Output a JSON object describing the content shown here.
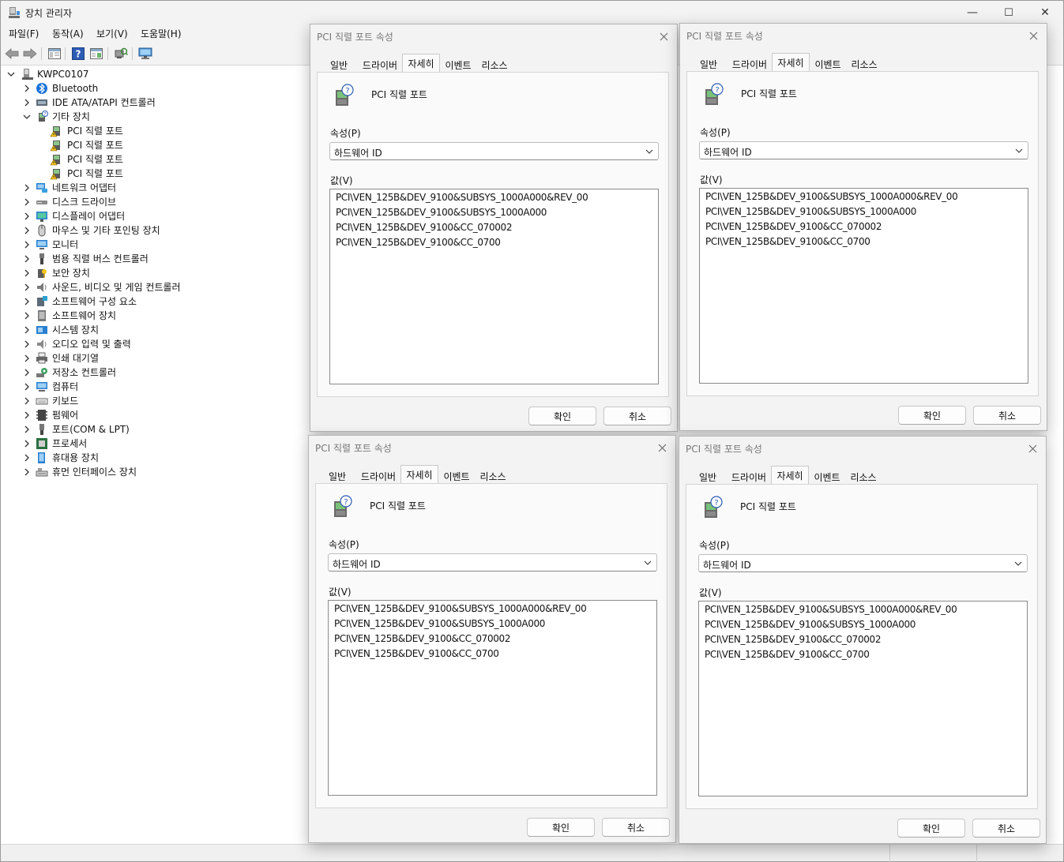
{
  "window": {
    "title": "장치 관리자",
    "controls": {
      "minimize": "—",
      "maximize": "☐",
      "close": "✕"
    }
  },
  "menu": [
    "파일(F)",
    "동작(A)",
    "보기(V)",
    "도움말(H)"
  ],
  "tree": {
    "root": "KWPC0107",
    "items": [
      {
        "label": "Bluetooth",
        "icon": "bluetooth-icon",
        "state": "collapsed"
      },
      {
        "label": "IDE ATA/ATAPI 컨트롤러",
        "icon": "ide-controller-icon",
        "state": "collapsed"
      },
      {
        "label": "기타 장치",
        "icon": "unknown-device-icon",
        "state": "expanded",
        "children": [
          {
            "label": "PCI 직렬 포트",
            "icon": "warning-device-icon"
          },
          {
            "label": "PCI 직렬 포트",
            "icon": "warning-device-icon"
          },
          {
            "label": "PCI 직렬 포트",
            "icon": "warning-device-icon"
          },
          {
            "label": "PCI 직렬 포트",
            "icon": "warning-device-icon"
          }
        ]
      },
      {
        "label": "네트워크 어댑터",
        "icon": "network-adapter-icon",
        "state": "collapsed"
      },
      {
        "label": "디스크 드라이브",
        "icon": "disk-drive-icon",
        "state": "collapsed"
      },
      {
        "label": "디스플레이 어댑터",
        "icon": "display-adapter-icon",
        "state": "collapsed"
      },
      {
        "label": "마우스 및 기타 포인팅 장치",
        "icon": "mouse-icon",
        "state": "collapsed"
      },
      {
        "label": "모니터",
        "icon": "monitor-icon",
        "state": "collapsed"
      },
      {
        "label": "범용 직렬 버스 컨트롤러",
        "icon": "usb-icon",
        "state": "collapsed"
      },
      {
        "label": "보안 장치",
        "icon": "security-device-icon",
        "state": "collapsed"
      },
      {
        "label": "사운드, 비디오 및 게임 컨트롤러",
        "icon": "speaker-icon",
        "state": "collapsed"
      },
      {
        "label": "소프트웨어 구성 요소",
        "icon": "software-component-icon",
        "state": "collapsed"
      },
      {
        "label": "소프트웨어 장치",
        "icon": "software-device-icon",
        "state": "collapsed"
      },
      {
        "label": "시스템 장치",
        "icon": "system-device-icon",
        "state": "collapsed"
      },
      {
        "label": "오디오 입력 및 출력",
        "icon": "audio-icon",
        "state": "collapsed"
      },
      {
        "label": "인쇄 대기열",
        "icon": "printer-icon",
        "state": "collapsed"
      },
      {
        "label": "저장소 컨트롤러",
        "icon": "storage-controller-icon",
        "state": "collapsed"
      },
      {
        "label": "컴퓨터",
        "icon": "computer-icon",
        "state": "collapsed"
      },
      {
        "label": "키보드",
        "icon": "keyboard-icon",
        "state": "collapsed"
      },
      {
        "label": "펌웨어",
        "icon": "firmware-icon",
        "state": "collapsed"
      },
      {
        "label": "포트(COM & LPT)",
        "icon": "port-icon",
        "state": "collapsed"
      },
      {
        "label": "프로세서",
        "icon": "processor-icon",
        "state": "collapsed"
      },
      {
        "label": "휴대용 장치",
        "icon": "portable-device-icon",
        "state": "collapsed"
      },
      {
        "label": "휴먼 인터페이스 장치",
        "icon": "hid-icon",
        "state": "collapsed"
      }
    ]
  },
  "dialogs": [
    {
      "title": "PCI 직렬 포트 속성",
      "tabs": [
        "일반",
        "드라이버",
        "자세히",
        "이벤트",
        "리소스"
      ],
      "active_tab": "자세히",
      "device_name": "PCI 직렬 포트",
      "property_label": "속성(P)",
      "property_value": "하드웨어 ID",
      "value_label": "값(V)",
      "values": [
        "PCI\\VEN_125B&DEV_9100&SUBSYS_1000A000&REV_00",
        "PCI\\VEN_125B&DEV_9100&SUBSYS_1000A000",
        "PCI\\VEN_125B&DEV_9100&CC_070002",
        "PCI\\VEN_125B&DEV_9100&CC_0700"
      ],
      "ok_label": "확인",
      "cancel_label": "취소"
    },
    {
      "title": "PCI 직렬 포트 속성",
      "tabs": [
        "일반",
        "드라이버",
        "자세히",
        "이벤트",
        "리소스"
      ],
      "active_tab": "자세히",
      "device_name": "PCI 직렬 포트",
      "property_label": "속성(P)",
      "property_value": "하드웨어 ID",
      "value_label": "값(V)",
      "values": [
        "PCI\\VEN_125B&DEV_9100&SUBSYS_1000A000&REV_00",
        "PCI\\VEN_125B&DEV_9100&SUBSYS_1000A000",
        "PCI\\VEN_125B&DEV_9100&CC_070002",
        "PCI\\VEN_125B&DEV_9100&CC_0700"
      ],
      "ok_label": "확인",
      "cancel_label": "취소"
    },
    {
      "title": "PCI 직렬 포트 속성",
      "tabs": [
        "일반",
        "드라이버",
        "자세히",
        "이벤트",
        "리소스"
      ],
      "active_tab": "자세히",
      "device_name": "PCI 직렬 포트",
      "property_label": "속성(P)",
      "property_value": "하드웨어 ID",
      "value_label": "값(V)",
      "values": [
        "PCI\\VEN_125B&DEV_9100&SUBSYS_1000A000&REV_00",
        "PCI\\VEN_125B&DEV_9100&SUBSYS_1000A000",
        "PCI\\VEN_125B&DEV_9100&CC_070002",
        "PCI\\VEN_125B&DEV_9100&CC_0700"
      ],
      "ok_label": "확인",
      "cancel_label": "취소"
    },
    {
      "title": "PCI 직렬 포트 속성",
      "tabs": [
        "일반",
        "드라이버",
        "자세히",
        "이벤트",
        "리소스"
      ],
      "active_tab": "자세히",
      "device_name": "PCI 직렬 포트",
      "property_label": "속성(P)",
      "property_value": "하드웨어 ID",
      "value_label": "값(V)",
      "values": [
        "PCI\\VEN_125B&DEV_9100&SUBSYS_1000A000&REV_00",
        "PCI\\VEN_125B&DEV_9100&SUBSYS_1000A000",
        "PCI\\VEN_125B&DEV_9100&CC_070002",
        "PCI\\VEN_125B&DEV_9100&CC_0700"
      ],
      "ok_label": "확인",
      "cancel_label": "취소"
    }
  ]
}
